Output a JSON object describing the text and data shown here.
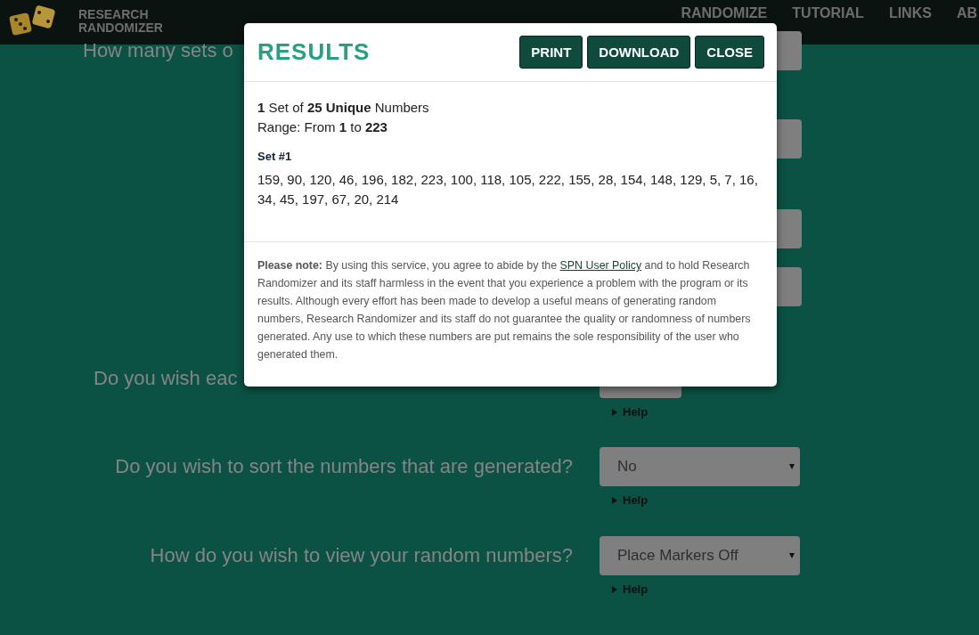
{
  "header": {
    "logo_lines": [
      "RESEARCH",
      "RANDOMIZER"
    ],
    "nav": [
      {
        "label": "RANDOMIZE"
      },
      {
        "label": "TUTORIAL"
      },
      {
        "label": "LINKS"
      },
      {
        "label": "AB"
      }
    ]
  },
  "form": [
    {
      "label": "How many sets o",
      "kind": "input"
    },
    {
      "kind": "input"
    },
    {
      "kind": "input"
    },
    {
      "kind": "input"
    },
    {
      "label": "Do you wish eac",
      "kind": "select",
      "help": "Help"
    },
    {
      "label": "Do you wish to sort the numbers that are generated?",
      "kind": "select",
      "value": "No",
      "help": "Help"
    },
    {
      "label": "How do you wish to view your random numbers?",
      "kind": "select",
      "value": "Place Markers Off",
      "help": "Help"
    }
  ],
  "modal": {
    "title": "RESULTS",
    "buttons": [
      "PRINT",
      "DOWNLOAD",
      "CLOSE"
    ],
    "summary": [
      "**1** Set of **25 Unique** Numbers",
      "Range: From **1** to **223**"
    ],
    "set_title": "Set #1",
    "numbers": "159, 90, 120, 46, 196, 182, 223, 100, 118, 105, 222, 155, 28, 154, 148, 129, 5, 7, 16, 34, 45, 197, 67, 20, 214",
    "note": {
      "before": "**Please note:** By using this service, you agree to abide by the ",
      "link": "SPN User Policy",
      "after": " and to hold Research Randomizer and its staff harmless in the event that you experience a problem with the program or its results. Although every effort has been made to develop a useful means of generating random numbers, Research Randomizer and its staff do not guarantee the quality or randomness of numbers generated. Any use to which these numbers are put remains the sole responsibility of the user who generated them."
    }
  }
}
